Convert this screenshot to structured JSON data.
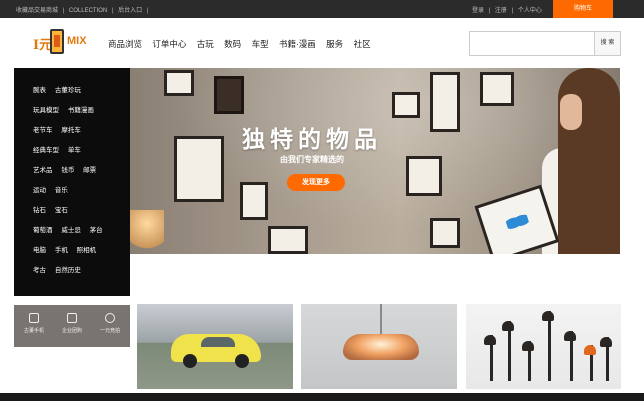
{
  "topbar": {
    "left_links": [
      "收藏品交易商城",
      "|",
      "COLLECTION",
      "|",
      "后台入口",
      "|"
    ],
    "right_links": [
      "登录",
      "|",
      "注册",
      "|",
      "个人中心"
    ],
    "cart_label": "购物车"
  },
  "logo": {
    "part1": "I元",
    "part2": "MIX"
  },
  "nav": [
    "商品浏览",
    "订单中心",
    "古玩",
    "数码",
    "车型",
    "书籍·漫画",
    "服务",
    "社区"
  ],
  "search": {
    "placeholder": "",
    "button_label": "搜 索"
  },
  "categories": [
    [
      "腕表",
      "古董珍玩"
    ],
    [
      "玩具模型",
      "书籍漫画"
    ],
    [
      "老节车",
      "摩托车"
    ],
    [
      "经典车型",
      "单车"
    ],
    [
      "艺术品",
      "钱币",
      "邮票"
    ],
    [
      "运动",
      "音乐"
    ],
    [
      "钻石",
      "宝石"
    ],
    [
      "葡萄酒",
      "威士忌",
      "茅台"
    ],
    [
      "电脑",
      "手机",
      "照相机"
    ],
    [
      "考古",
      "自然历史"
    ]
  ],
  "hero": {
    "title": "独特的物品",
    "subtitle": "由我们专家精选的",
    "button_label": "发现更多"
  },
  "quick_links": [
    "古董手机",
    "企业团购",
    "一元竞拍"
  ],
  "colors": {
    "accent": "#ff6a00",
    "topbar": "#2b2b2b",
    "sidebar": "#0c0c0c"
  },
  "icons": [
    "phone-icon",
    "gift-icon",
    "auction-icon"
  ]
}
